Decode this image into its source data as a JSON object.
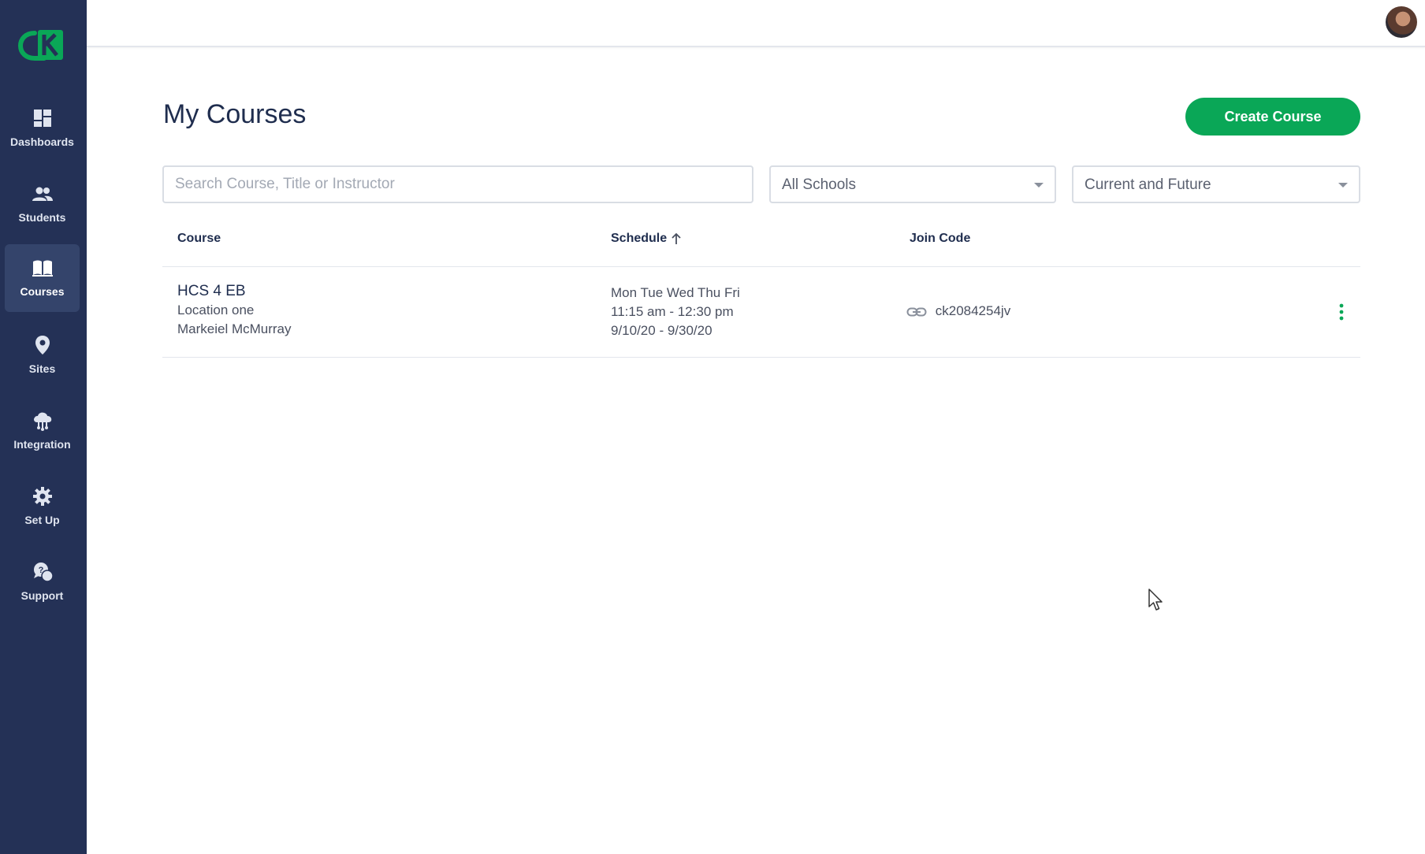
{
  "sidebar": {
    "items": [
      {
        "label": "Dashboards",
        "icon": "dashboard-icon",
        "active": false
      },
      {
        "label": "Students",
        "icon": "people-icon",
        "active": false
      },
      {
        "label": "Courses",
        "icon": "book-icon",
        "active": true
      },
      {
        "label": "Sites",
        "icon": "location-pin-icon",
        "active": false
      },
      {
        "label": "Integration",
        "icon": "cloud-network-icon",
        "active": false
      },
      {
        "label": "Set Up",
        "icon": "gear-icon",
        "active": false
      },
      {
        "label": "Support",
        "icon": "help-chat-icon",
        "active": false
      }
    ]
  },
  "colors": {
    "sidebar_bg": "#243156",
    "sidebar_active": "#34446b",
    "accent_green": "#0aa757",
    "title_navy": "#1f2d4e"
  },
  "main": {
    "title": "My Courses",
    "create_button": "Create Course",
    "search": {
      "placeholder": "Search Course, Title or Instructor",
      "value": ""
    },
    "school_filter": {
      "value": "All Schools"
    },
    "date_filter": {
      "value": "Current and Future"
    },
    "table": {
      "headers": {
        "course": "Course",
        "schedule": "Schedule",
        "join_code": "Join Code"
      },
      "sort": {
        "column": "schedule",
        "direction": "ascending"
      },
      "rows": [
        {
          "title": "HCS 4 EB",
          "location": "Location one",
          "instructor": "Markeiel McMurray",
          "days": "Mon Tue Wed Thu Fri",
          "time": "11:15 am - 12:30 pm",
          "dates": "9/10/20 - 9/30/20",
          "join_code": "ck2084254jv"
        }
      ]
    }
  }
}
